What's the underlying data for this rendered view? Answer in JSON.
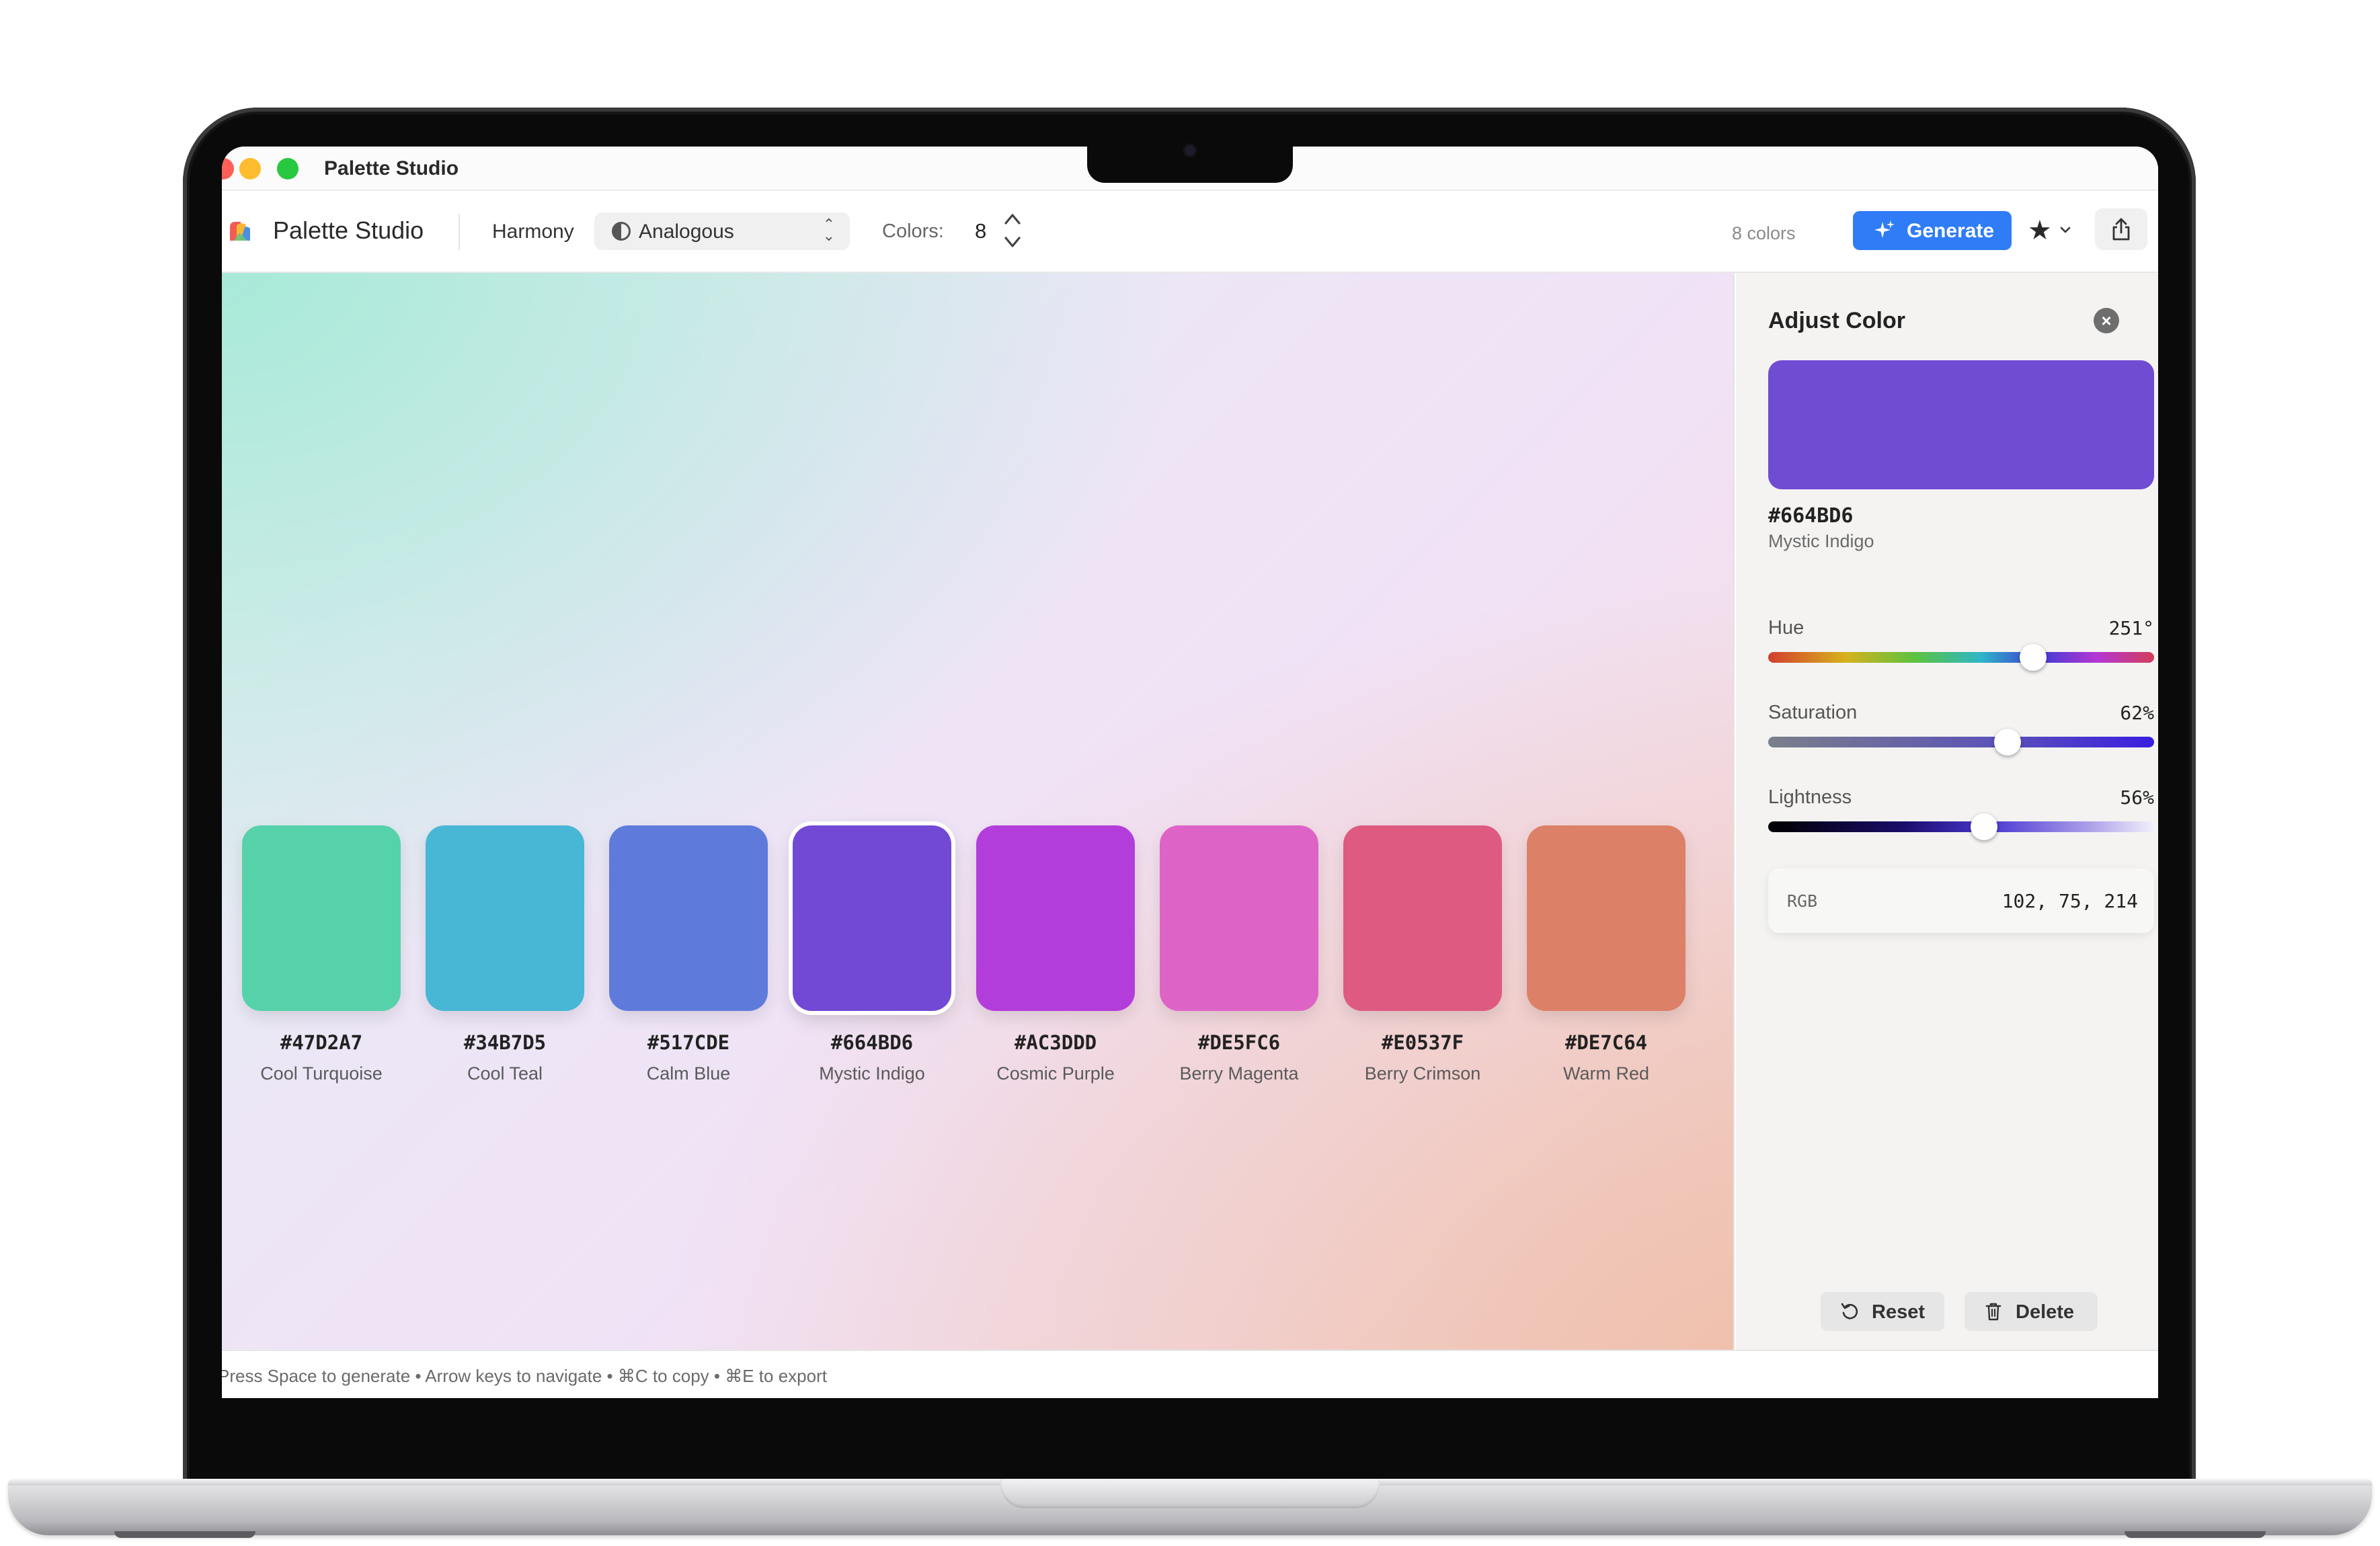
{
  "window": {
    "title": "Palette Studio"
  },
  "toolbar": {
    "app_name": "Palette Studio",
    "harmony_label": "Harmony",
    "harmony_value": "Analogous",
    "colors_label": "Colors:",
    "colors_value": "8",
    "count_label": "8 colors",
    "generate_label": "Generate"
  },
  "palette": [
    {
      "hex": "#47D2A7",
      "name": "Cool Turquoise",
      "color": "#55d2aa",
      "selected": false
    },
    {
      "hex": "#34B7D5",
      "name": "Cool Teal",
      "color": "#48b6d5",
      "selected": false
    },
    {
      "hex": "#517CDE",
      "name": "Calm Blue",
      "color": "#5e7bdc",
      "selected": false
    },
    {
      "hex": "#664BD6",
      "name": "Mystic Indigo",
      "color": "#7249d4",
      "selected": true
    },
    {
      "hex": "#AC3DDD",
      "name": "Cosmic Purple",
      "color": "#b33dda",
      "selected": false
    },
    {
      "hex": "#DE5FC6",
      "name": "Berry Magenta",
      "color": "#de63c7",
      "selected": false
    },
    {
      "hex": "#E0537F",
      "name": "Berry Crimson",
      "color": "#de5a80",
      "selected": false
    },
    {
      "hex": "#DE7C64",
      "name": "Warm Red",
      "color": "#dd8068",
      "selected": false
    }
  ],
  "panel": {
    "title": "Adjust Color",
    "preview_color": "#704cd3",
    "hex": "#664BD6",
    "name": "Mystic Indigo",
    "hue": {
      "label": "Hue",
      "value": "251°",
      "fraction": 0.687
    },
    "saturation": {
      "label": "Saturation",
      "value": "62%",
      "fraction": 0.62
    },
    "lightness": {
      "label": "Lightness",
      "value": "56%",
      "fraction": 0.56
    },
    "rgb_label": "RGB",
    "rgb_value": "102, 75, 214",
    "reset_label": "Reset",
    "delete_label": "Delete"
  },
  "statusbar": {
    "hint": "Press Space to generate • Arrow keys to navigate • ⌘C to copy • ⌘E to export"
  }
}
